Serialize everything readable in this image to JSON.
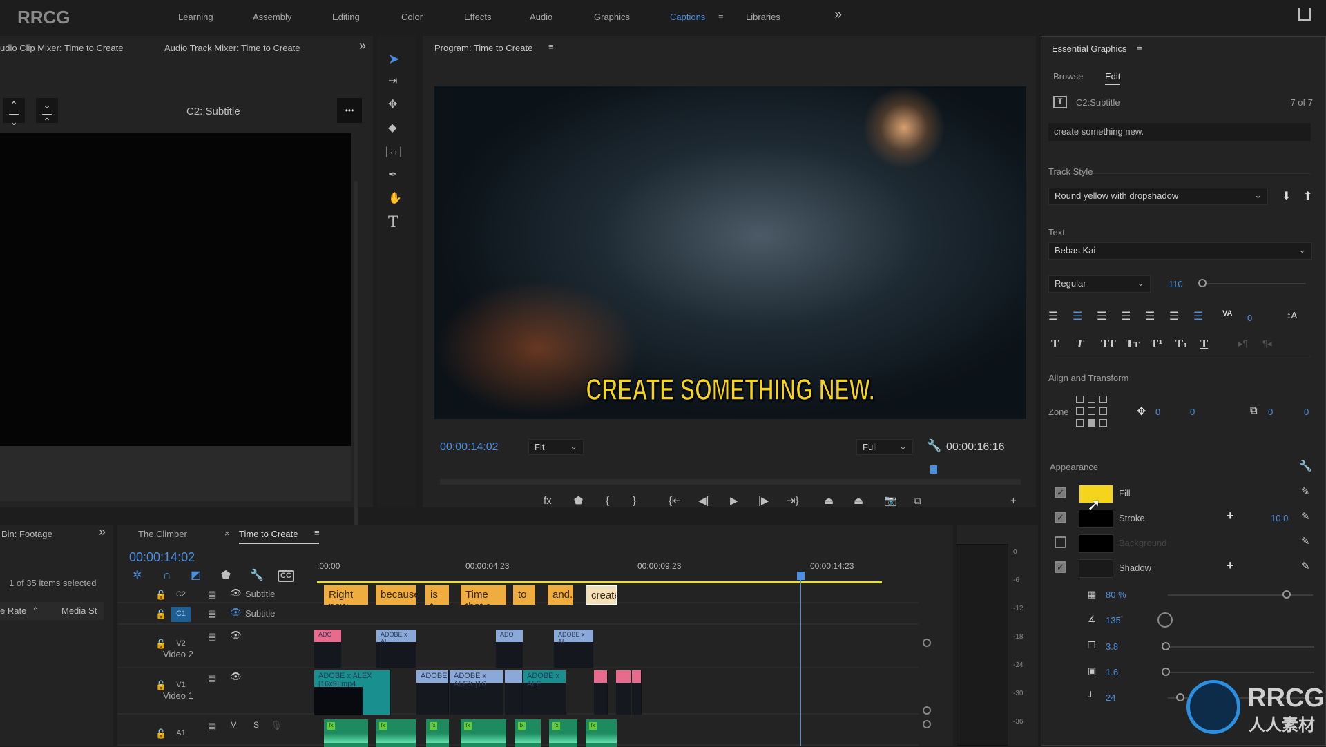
{
  "app": {
    "logo": "RRCG",
    "workspaces": [
      "Learning",
      "Assembly",
      "Editing",
      "Color",
      "Effects",
      "Audio",
      "Graphics",
      "Captions",
      "Libraries"
    ],
    "active_workspace": "Captions",
    "overflow": "»"
  },
  "left_panel": {
    "tabs": [
      "udio Clip Mixer: Time to Create",
      "Audio Track Mixer: Time to Create"
    ],
    "overflow": "»",
    "title": "C2: Subtitle",
    "more": "•••"
  },
  "program": {
    "title": "Program: Time to Create",
    "caption": "CREATE SOMETHING NEW.",
    "caption_color": "#f5d41e",
    "timecode": "00:00:14:02",
    "zoom": "Fit",
    "resolution": "Full",
    "duration": "00:00:16:16",
    "playhead_fraction": 0.85
  },
  "bin": {
    "title": "Bin: Footage",
    "overflow": "»",
    "status": "1 of 35 items selected",
    "col1": "e Rate",
    "col2": "Media St"
  },
  "timeline": {
    "tabs": [
      "The Climber",
      "Time to Create"
    ],
    "close": "×",
    "timecode": "00:00:14:02",
    "ruler": [
      ":00:00",
      "00:00:04:23",
      "00:00:09:23",
      "00:00:14:23"
    ],
    "tracks": [
      {
        "id": "C2",
        "name": "Subtitle"
      },
      {
        "id": "C1",
        "name": "Subtitle"
      },
      {
        "id": "V2",
        "name": "Video 2"
      },
      {
        "id": "V1",
        "name": "Video 1"
      },
      {
        "id": "A1",
        "name": "",
        "m": "M",
        "s": "S"
      }
    ],
    "captions": [
      "Right now ...",
      "because ...",
      "is t...",
      "Time that c...",
      "to ...",
      "and...",
      "create..."
    ],
    "v2_clips": [
      "ADO",
      "ADOBE x AL",
      "ADO",
      "ADOBE x AL"
    ],
    "v1_clips": [
      "ADOBE x ALEX [16x9].mp4",
      "ADOBE",
      "ADOBE x ALEX [16",
      "",
      "ADOBE x ALE",
      "",
      "",
      ""
    ],
    "meter": [
      "0",
      "-6",
      "-12",
      "-18",
      "-24",
      "-30",
      "-36"
    ]
  },
  "essential_graphics": {
    "title": "Essential Graphics",
    "tabs": [
      "Browse",
      "Edit"
    ],
    "active_tab": "Edit",
    "layer": "C2:Subtitle",
    "count": "7 of 7",
    "text_value": "create something new.",
    "track_style_label": "Track Style",
    "track_style": "Round yellow with dropshadow",
    "text_label": "Text",
    "font": "Bebas Kai",
    "font_style": "Regular",
    "font_size": "110",
    "tracking": "0",
    "align_label": "Align and Transform",
    "zone_label": "Zone",
    "pos_x": "0",
    "pos_y": "0",
    "scale_x": "0",
    "scale_y": "0",
    "appearance_label": "Appearance",
    "fill": {
      "label": "Fill",
      "checked": true,
      "color": "#f5d41e"
    },
    "stroke": {
      "label": "Stroke",
      "checked": true,
      "color": "#000000",
      "width": "10.0"
    },
    "background": {
      "label": "Background",
      "checked": false,
      "color": "#000000"
    },
    "shadow": {
      "label": "Shadow",
      "checked": true,
      "color": "#1a1a1a",
      "opacity": "80 %",
      "angle": "135",
      "angle_unit": "°",
      "distance": "3.8",
      "size": "1.6",
      "blur": "24"
    }
  },
  "watermark": {
    "brand": "RRCG",
    "sub": "人人素材"
  }
}
